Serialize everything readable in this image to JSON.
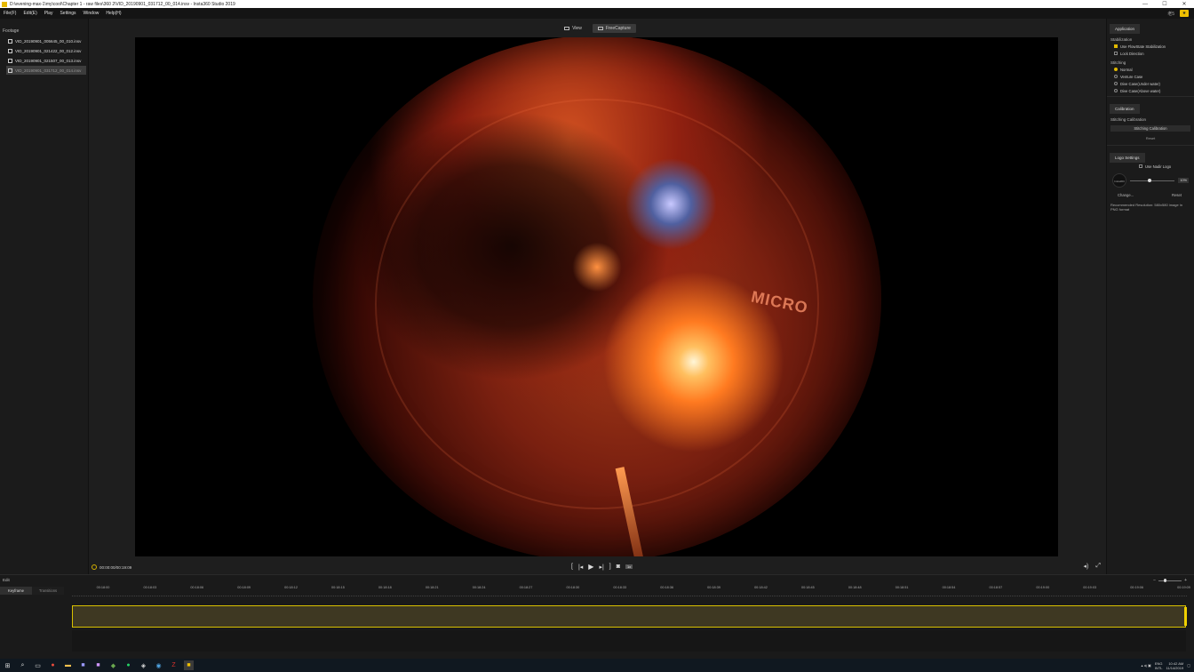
{
  "window": {
    "title": "D:\\evening-max-1\\my\\cool\\Chapter 1 - raw files\\360 2\\VID_20190901_031712_00_014.insv - Insta360 Studio 2019",
    "controls": {
      "minimize": "—",
      "maximize": "☐",
      "close": "✕"
    }
  },
  "menu": {
    "items": [
      "File(F)",
      "Edit(E)",
      "Play",
      "Settings",
      "Window",
      "Help(H)"
    ],
    "account": "老5",
    "gift_icon": "gift-icon"
  },
  "footage": {
    "heading": "Footage",
    "files": [
      {
        "name": "VID_20190901_005645_00_010.insv",
        "active": false
      },
      {
        "name": "VID_20190901_021422_00_012.insv",
        "active": false
      },
      {
        "name": "VID_20190901_021507_00_013.insv",
        "active": false
      },
      {
        "name": "VID_20190901_031712_00_014.insv",
        "active": true
      }
    ]
  },
  "viewer": {
    "tabs": [
      {
        "label": "View",
        "active": false
      },
      {
        "label": "FreeCapture",
        "active": true
      }
    ],
    "brand_text": "MICRO"
  },
  "playback": {
    "timecode": "00:00:00/00:19:09",
    "speed": "1x",
    "icons": [
      "bracket-in-icon",
      "prev-frame-icon",
      "play-icon",
      "next-frame-icon",
      "bracket-out-icon",
      "snapshot-icon"
    ]
  },
  "right_panel": {
    "tab_application": "Application",
    "stabilization_heading": "Stabilization",
    "stabilization_options": [
      {
        "label": "Use FlowState Stabilization",
        "checked": true
      },
      {
        "label": "Lock Direction",
        "checked": false
      }
    ],
    "stitching_heading": "Stitching",
    "stitching_options": [
      {
        "label": "Normal",
        "selected": true
      },
      {
        "label": "Venture Case",
        "selected": false
      },
      {
        "label": "Dive Case(Under water)",
        "selected": false
      },
      {
        "label": "Dive Case(Above water)",
        "selected": false
      }
    ],
    "tab_calibration": "Calibration",
    "stitching_calibration_heading": "Stitching Calibration",
    "stitching_calibration_button": "Stitching Calibration",
    "reset_link": "Reset",
    "tab_logo": "Logo Settings",
    "use_nadir_logo": "Use Nadir Logo",
    "logo_placeholder": "Insta360",
    "logo_percent": "10%",
    "change_label": "Change...",
    "logo_reset": "Reset",
    "hint": "Recommended Resolution: 580x580 image in PNG format"
  },
  "timeline": {
    "heading": "Edit",
    "tabs": [
      {
        "label": "Keyframe",
        "active": true
      },
      {
        "label": "Transitions",
        "active": false
      }
    ],
    "ticks": [
      "00:18:00",
      "00:18:03",
      "00:18:06",
      "00:18:09",
      "00:18:12",
      "00:18:15",
      "00:18:18",
      "00:18:21",
      "00:18:24",
      "00:18:27",
      "00:18:30",
      "00:18:33",
      "00:18:36",
      "00:18:39",
      "00:18:42",
      "00:18:45",
      "00:18:48",
      "00:18:51",
      "00:18:54",
      "00:18:57",
      "00:19:00",
      "00:19:03",
      "00:19:06",
      "00:19:09"
    ]
  },
  "taskbar": {
    "icons": [
      "windows-start-icon",
      "search-icon",
      "task-view-icon",
      "chrome-icon",
      "file-explorer-icon",
      "premiere-icon",
      "after-effects-icon",
      "app-green-icon",
      "whatsapp-icon",
      "app-dark-icon",
      "photos-icon",
      "filezilla-icon",
      "insta360-icon"
    ],
    "lang_top": "ENG",
    "lang_bottom": "INTL",
    "time": "10:42 AM",
    "date": "11/14/2019"
  },
  "colors": {
    "accent": "#e0b800",
    "background": "#1e1e1e",
    "panel": "#1b1b1b"
  }
}
